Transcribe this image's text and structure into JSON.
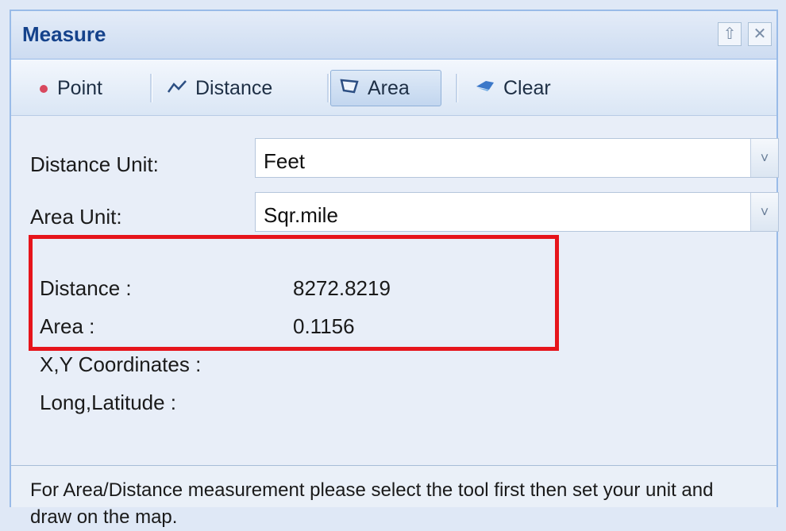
{
  "panel": {
    "title": "Measure",
    "buttons": {
      "collapse_icon": "collapse-up-icon",
      "close_icon": "close-icon"
    }
  },
  "toolbar": {
    "items": [
      {
        "label": "Point",
        "icon": "point-icon",
        "active": false
      },
      {
        "label": "Distance",
        "icon": "distance-icon",
        "active": false
      },
      {
        "label": "Area",
        "icon": "area-icon",
        "active": true
      },
      {
        "label": "Clear",
        "icon": "clear-icon",
        "active": false
      }
    ]
  },
  "form": {
    "distance_unit_label": "Distance Unit:",
    "distance_unit_value": "Feet",
    "area_unit_label": "Area Unit:",
    "area_unit_value": "Sqr.mile"
  },
  "results": {
    "distance_label": "Distance :",
    "distance_value": "8272.8219",
    "area_label": "Area :",
    "area_value": "0.1156",
    "xy_label": "X,Y Coordinates :",
    "longlat_label": "Long,Latitude :"
  },
  "footer": {
    "text": "For Area/Distance measurement please select the tool first then set your unit and draw on the map."
  },
  "colors": {
    "highlight": "#e6141b",
    "title": "#15428b"
  }
}
